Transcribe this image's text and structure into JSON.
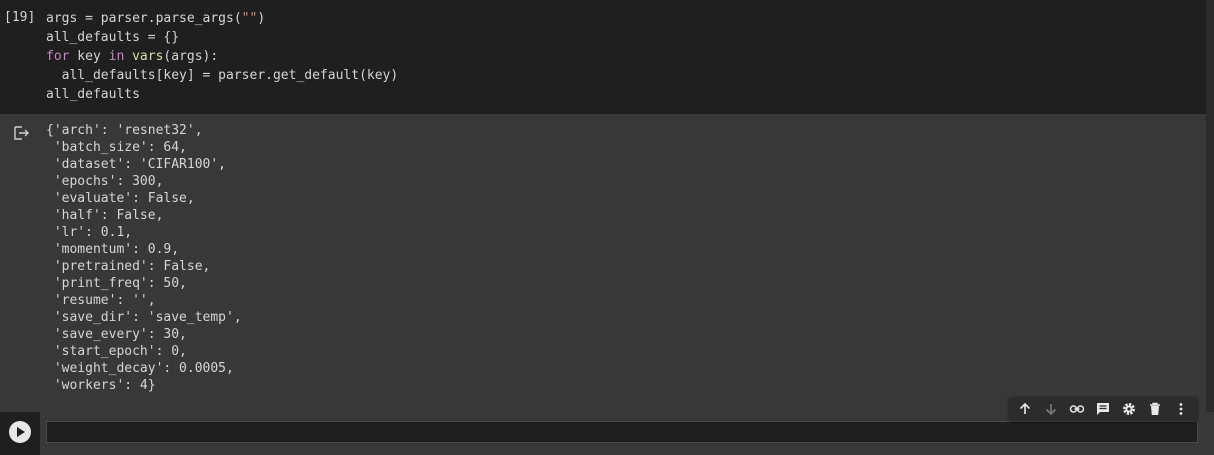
{
  "cell_1": {
    "execution_count": "[19]",
    "code": [
      [
        {
          "t": "args = parser.parse_args(",
          "c": ""
        },
        {
          "t": "\"\"",
          "c": "str"
        },
        {
          "t": ")",
          "c": ""
        }
      ],
      [
        {
          "t": "all_defaults = {}",
          "c": ""
        }
      ],
      [
        {
          "t": "for",
          "c": "kw"
        },
        {
          "t": " key ",
          "c": ""
        },
        {
          "t": "in",
          "c": "kw"
        },
        {
          "t": " ",
          "c": ""
        },
        {
          "t": "vars",
          "c": "fn"
        },
        {
          "t": "(args):",
          "c": ""
        }
      ],
      [
        {
          "t": "  all_defaults[key] = parser.get_default(key)",
          "c": ""
        }
      ],
      [
        {
          "t": "all_defaults",
          "c": ""
        }
      ]
    ],
    "output_lines": [
      "{'arch': 'resnet32',",
      " 'batch_size': 64,",
      " 'dataset': 'CIFAR100',",
      " 'epochs': 300,",
      " 'evaluate': False,",
      " 'half': False,",
      " 'lr': 0.1,",
      " 'momentum': 0.9,",
      " 'pretrained': False,",
      " 'print_freq': 50,",
      " 'resume': '',",
      " 'save_dir': 'save_temp',",
      " 'save_every': 30,",
      " 'start_epoch': 0,",
      " 'weight_decay': 0.0005,",
      " 'workers': 4}"
    ]
  },
  "toolbar": {
    "buttons": [
      {
        "name": "move-up-icon"
      },
      {
        "name": "move-down-icon"
      },
      {
        "name": "link-icon"
      },
      {
        "name": "comment-icon"
      },
      {
        "name": "gear-icon"
      },
      {
        "name": "trash-icon"
      },
      {
        "name": "more-vert-icon"
      }
    ]
  },
  "cell_2": {
    "run_icon": "play-icon",
    "code": ""
  },
  "colors": {
    "code_bg": "#1f1f1f",
    "output_bg": "#383838",
    "keyword": "#c586c0",
    "function": "#dcdcaa",
    "string": "#ce9178"
  }
}
